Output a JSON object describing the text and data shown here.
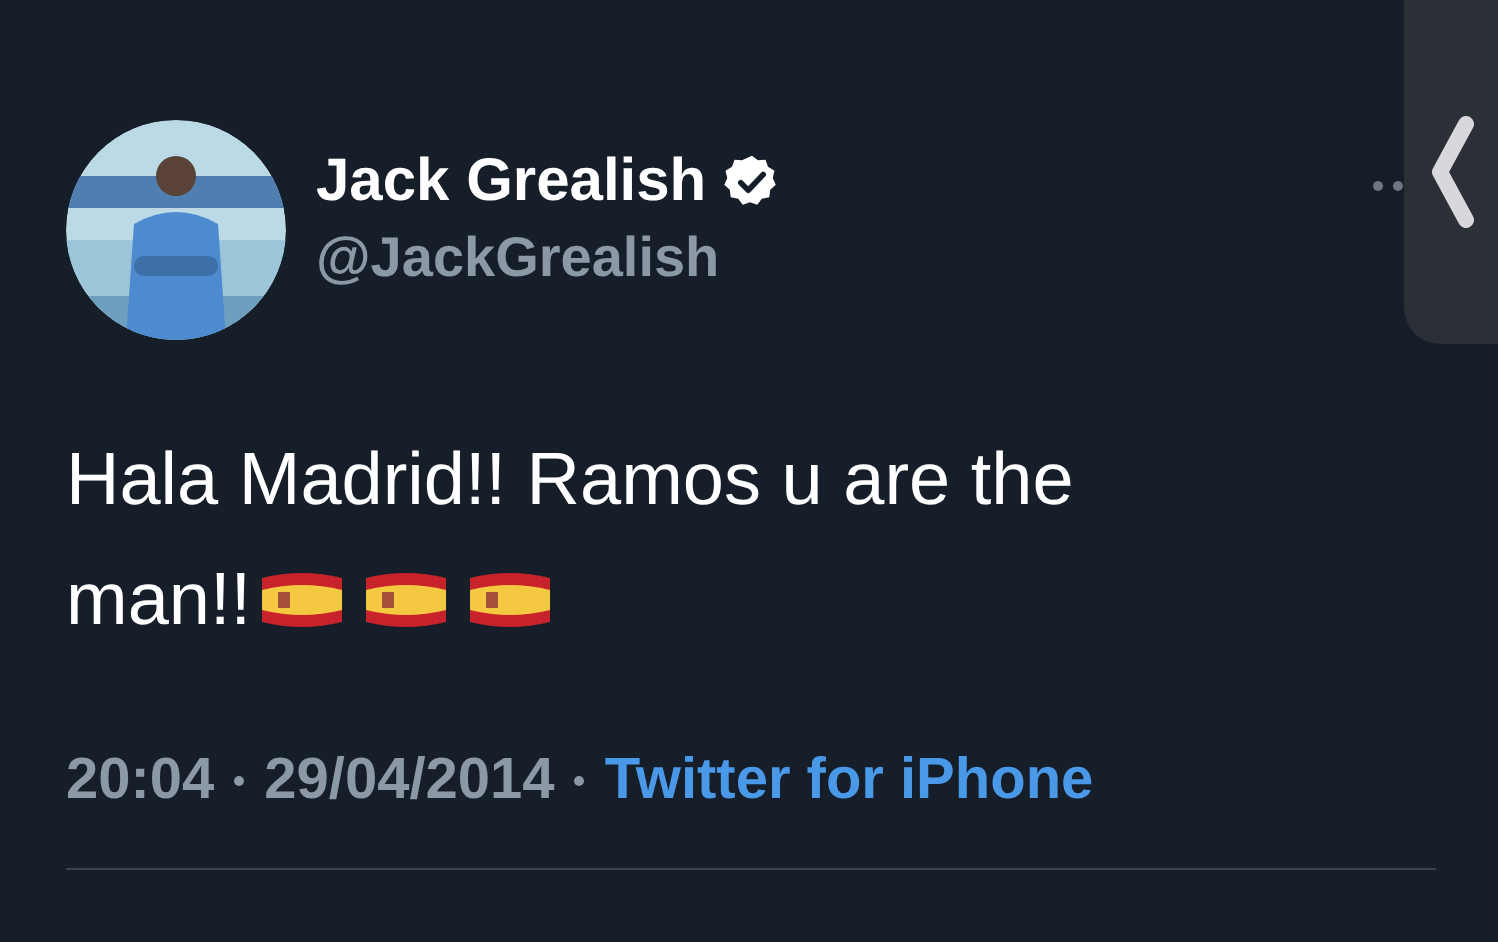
{
  "tweet": {
    "author": {
      "name": "Jack Grealish",
      "handle": "@JackGrealish",
      "verified": true
    },
    "text_lines": [
      "Hala Madrid!! Ramos u are the",
      "man!!"
    ],
    "emoji": [
      {
        "kind": "spain-flag"
      },
      {
        "kind": "spain-flag"
      },
      {
        "kind": "spain-flag"
      }
    ],
    "time": "20:04",
    "date": "29/04/2014",
    "source": "Twitter for iPhone"
  }
}
